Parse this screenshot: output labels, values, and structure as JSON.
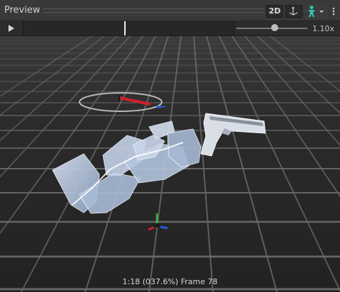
{
  "panel": {
    "title": "Preview",
    "toggle_2d_label": "2D",
    "pivot_icon": "pivot-icon",
    "avatar_icon": "avatar-icon",
    "menu_icon": "kebab-menu-icon"
  },
  "controls": {
    "play_icon": "play-icon",
    "speed_label": "1.10x"
  },
  "viewport": {
    "status_text": "1:18 (037.6%) Frame 78",
    "colors": {
      "x_axis": "#d0202a",
      "y_axis": "#2fbf4a",
      "z_axis": "#2a5bd8",
      "avatar_button": "#32c8b4",
      "model": "#b9cbe2"
    }
  }
}
